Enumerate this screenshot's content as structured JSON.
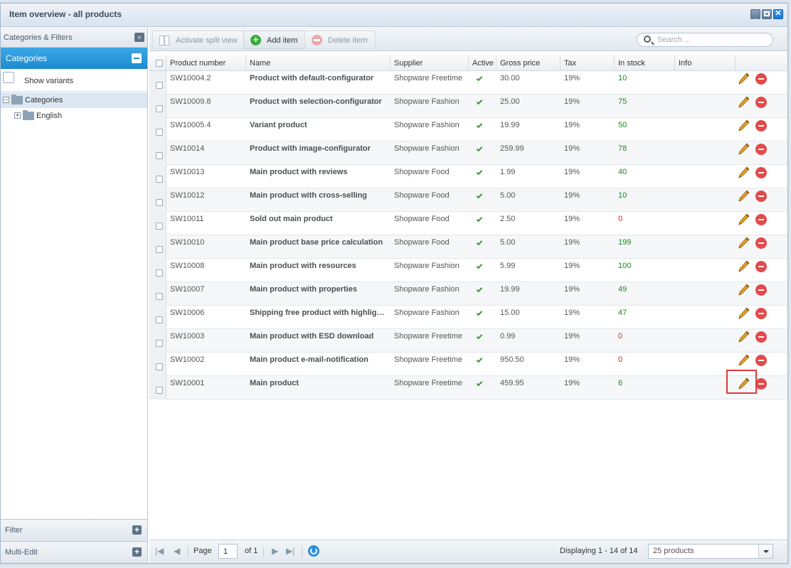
{
  "window": {
    "title": "Item overview - all products"
  },
  "sidebar": {
    "header": "Categories & Filters",
    "categories_title": "Categories",
    "show_variants_label": "Show variants",
    "tree": [
      {
        "label": "Categories"
      },
      {
        "label": "English"
      }
    ],
    "filter_label": "Filter",
    "multi_edit_label": "Multi-Edit"
  },
  "toolbar": {
    "split_view_label": "Activate split view",
    "add_label": "Add item",
    "delete_label": "Delete item",
    "search_placeholder": "Search ..."
  },
  "grid": {
    "columns": [
      "Product number",
      "Name",
      "Supplier",
      "Active",
      "Gross price",
      "Tax",
      "In stock",
      "Info"
    ],
    "rows": [
      {
        "number": "SW10004.2",
        "name": "Product with default-configurator",
        "supplier": "Shopware Freetime",
        "price": "30.00",
        "tax": "19%",
        "stock": "10"
      },
      {
        "number": "SW10009.8",
        "name": "Product with selection-configurator",
        "supplier": "Shopware Fashion",
        "price": "25.00",
        "tax": "19%",
        "stock": "75"
      },
      {
        "number": "SW10005.4",
        "name": "Variant product",
        "supplier": "Shopware Fashion",
        "price": "19.99",
        "tax": "19%",
        "stock": "50"
      },
      {
        "number": "SW10014",
        "name": "Product with image-configurator",
        "supplier": "Shopware Fashion",
        "price": "259.99",
        "tax": "19%",
        "stock": "78"
      },
      {
        "number": "SW10013",
        "name": "Main product with reviews",
        "supplier": "Shopware Food",
        "price": "1.99",
        "tax": "19%",
        "stock": "40"
      },
      {
        "number": "SW10012",
        "name": "Main product with cross-selling",
        "supplier": "Shopware Food",
        "price": "5.00",
        "tax": "19%",
        "stock": "10"
      },
      {
        "number": "SW10011",
        "name": "Sold out main product",
        "supplier": "Shopware Food",
        "price": "2.50",
        "tax": "19%",
        "stock": "0"
      },
      {
        "number": "SW10010",
        "name": "Main product base price calculation",
        "supplier": "Shopware Food",
        "price": "5.00",
        "tax": "19%",
        "stock": "199"
      },
      {
        "number": "SW10008",
        "name": "Main product with resources",
        "supplier": "Shopware Fashion",
        "price": "5.99",
        "tax": "19%",
        "stock": "100"
      },
      {
        "number": "SW10007",
        "name": "Main product with properties",
        "supplier": "Shopware Fashion",
        "price": "19.99",
        "tax": "19%",
        "stock": "49"
      },
      {
        "number": "SW10006",
        "name": "Shipping free product with highlig…",
        "supplier": "Shopware Fashion",
        "price": "15.00",
        "tax": "19%",
        "stock": "47"
      },
      {
        "number": "SW10003",
        "name": "Main product with ESD download",
        "supplier": "Shopware Freetime",
        "price": "0.99",
        "tax": "19%",
        "stock": "0"
      },
      {
        "number": "SW10002",
        "name": "Main product e-mail-notification",
        "supplier": "Shopware Freetime",
        "price": "950.50",
        "tax": "19%",
        "stock": "0"
      },
      {
        "number": "SW10001",
        "name": "Main product",
        "supplier": "Shopware Freetime",
        "price": "459.95",
        "tax": "19%",
        "stock": "6"
      }
    ]
  },
  "paging": {
    "page_label": "Page",
    "page_value": "1",
    "of_label": "of 1",
    "display_text": "Displaying 1 - 14 of 14",
    "per_page": "25 products"
  },
  "colors": {
    "accent": "#1d8bd0",
    "stock_positive": "#1a8a1a",
    "stock_zero": "#e02020",
    "highlight": "#e03a3a"
  }
}
